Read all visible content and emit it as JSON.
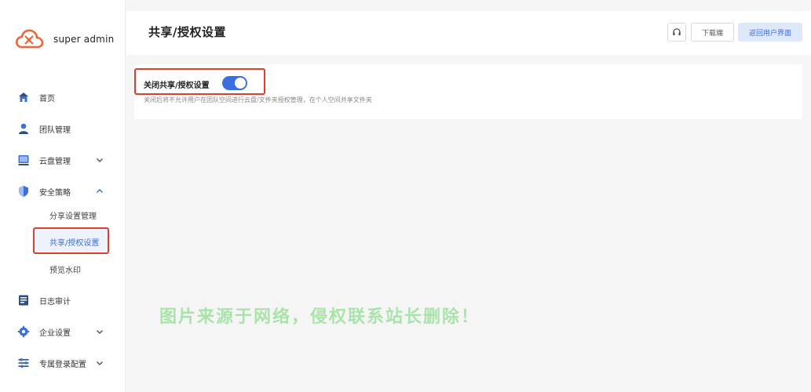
{
  "brand": {
    "name": "super admin"
  },
  "sidebar": {
    "items": [
      {
        "key": "home",
        "label": "首页",
        "icon": "home-icon",
        "has_caret": false
      },
      {
        "key": "team",
        "label": "团队管理",
        "icon": "user-icon",
        "has_caret": false
      },
      {
        "key": "disk",
        "label": "云盘管理",
        "icon": "disk-icon",
        "has_caret": true,
        "caret": "down"
      },
      {
        "key": "security",
        "label": "安全策略",
        "icon": "shield-icon",
        "has_caret": true,
        "caret": "up"
      },
      {
        "key": "audit",
        "label": "日志审计",
        "icon": "log-icon",
        "has_caret": false
      },
      {
        "key": "enterprise",
        "label": "企业设置",
        "icon": "gear-icon",
        "has_caret": true,
        "caret": "down"
      },
      {
        "key": "login",
        "label": "专属登录配置",
        "icon": "sliders-icon",
        "has_caret": true,
        "caret": "down"
      }
    ],
    "security_sub": [
      {
        "label": "分享设置管理",
        "active": false
      },
      {
        "label": "共享/授权设置",
        "active": true
      },
      {
        "label": "预览水印",
        "active": false
      }
    ]
  },
  "header": {
    "title": "共享/授权设置",
    "download_label": "下载端",
    "back_label": "返回用户界面",
    "headset_icon": "headset-icon"
  },
  "setting": {
    "label": "关闭共享/授权设置",
    "enabled": true,
    "description": "关闭后将不允许用户在团队空间进行云盘/文件夹授权管理，在个人空间共享文件夹"
  },
  "watermark": {
    "text": "图片来源于网络，侵权联系站长删除！"
  },
  "colors": {
    "accent": "#3a6fe0",
    "highlight": "#d9402f",
    "brand": "#e8683c"
  }
}
